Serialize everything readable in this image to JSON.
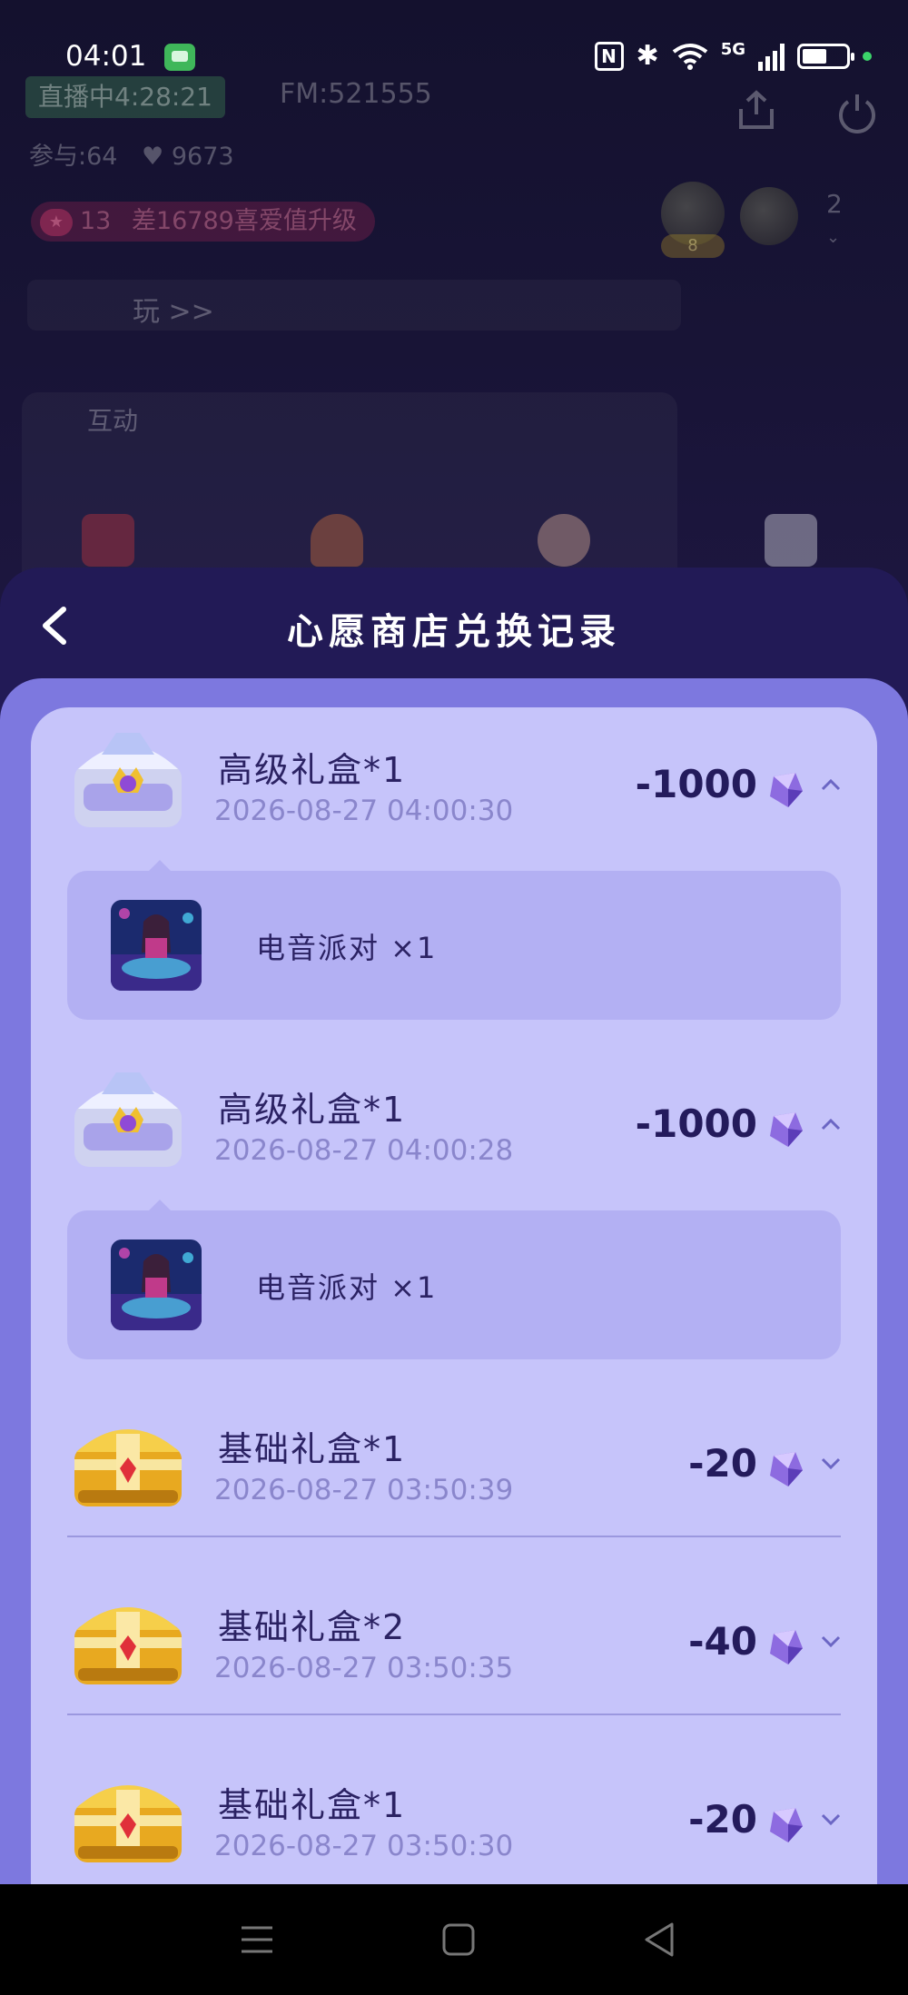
{
  "status_bar": {
    "time": "04:01",
    "network": "5G"
  },
  "room": {
    "live_status": "直播中4:28:21",
    "fm_id": "FM:521555",
    "participants": "参与:64",
    "likes": "9673",
    "level_number": "13",
    "level_hint": "差16789喜爱值升级",
    "avatar_badge": "8",
    "online_count": "2",
    "play_label": "玩 >>",
    "interact_label": "互动"
  },
  "sheet": {
    "title": "心愿商店兑换记录",
    "records": [
      {
        "name": "高级礼盒*1",
        "time": "2026-08-27 04:00:30",
        "amount": "-1000",
        "box": "premium",
        "expanded": true,
        "detail": "电音派对 ×1"
      },
      {
        "name": "高级礼盒*1",
        "time": "2026-08-27 04:00:28",
        "amount": "-1000",
        "box": "premium",
        "expanded": true,
        "detail": "电音派对 ×1"
      },
      {
        "name": "基础礼盒*1",
        "time": "2026-08-27 03:50:39",
        "amount": "-20",
        "box": "basic",
        "expanded": false
      },
      {
        "name": "基础礼盒*2",
        "time": "2026-08-27 03:50:35",
        "amount": "-40",
        "box": "basic",
        "expanded": false
      },
      {
        "name": "基础礼盒*1",
        "time": "2026-08-27 03:50:30",
        "amount": "-20",
        "box": "basic",
        "expanded": false
      }
    ]
  },
  "colors": {
    "sheet_header": "#221a56",
    "sheet_body": "#7d78df",
    "panel": "#c6c4fa",
    "detail": "#b3b0f3",
    "text_dark": "#241b5c",
    "text_muted": "#8a86cc"
  },
  "icons": [
    "back-icon",
    "gem-icon",
    "chevron-up-icon",
    "chevron-down-icon",
    "share-icon",
    "power-icon",
    "menu-icon",
    "home-icon",
    "back-triangle-icon"
  ]
}
